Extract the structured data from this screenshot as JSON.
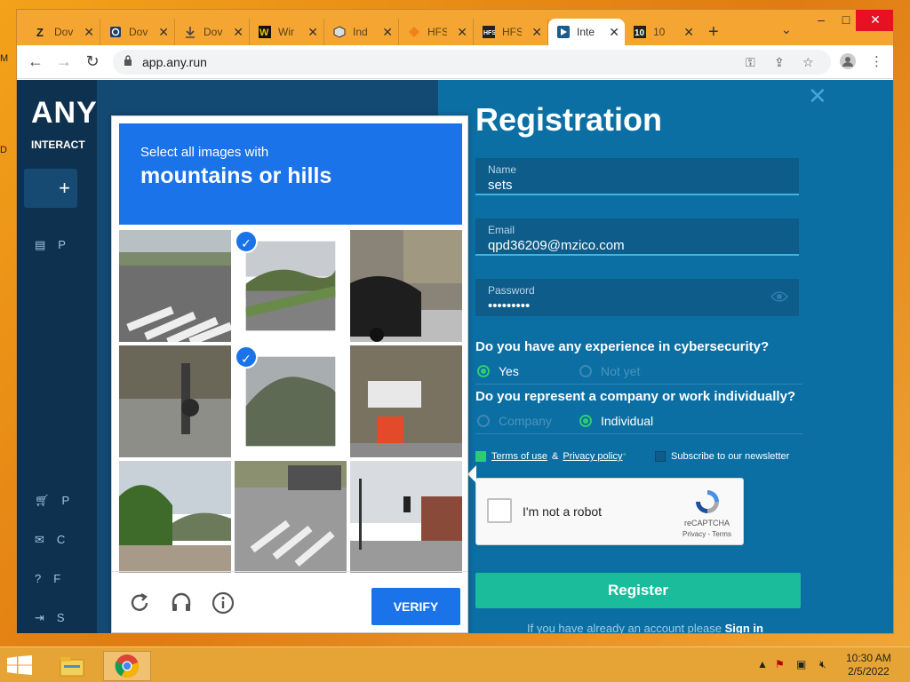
{
  "browser": {
    "tabs": [
      {
        "favicon": "zippyshare-icon",
        "label": "Dov"
      },
      {
        "favicon": "download-q-icon",
        "label": "Dov"
      },
      {
        "favicon": "download-arrow-icon",
        "label": "Dov"
      },
      {
        "favicon": "w-icon",
        "label": "Wir"
      },
      {
        "favicon": "index-icon",
        "label": "Ind"
      },
      {
        "favicon": "hfs-diamond-icon",
        "label": "HFS"
      },
      {
        "favicon": "hfs-icon",
        "label": "HFS"
      },
      {
        "favicon": "anyrun-icon",
        "label": "Inte"
      },
      {
        "favicon": "ten-icon",
        "label": "10"
      }
    ],
    "url": "app.any.run"
  },
  "sidebar": {
    "brand": "ANY",
    "subtitle": "INTERACT",
    "items": [
      {
        "icon": "document-icon",
        "label": "P"
      },
      {
        "icon": "cart-icon",
        "label": "P"
      },
      {
        "icon": "mail-icon",
        "label": "C"
      },
      {
        "icon": "help-icon",
        "label": "F"
      },
      {
        "icon": "signin-icon",
        "label": "S"
      }
    ]
  },
  "registration": {
    "title": "Registration",
    "name_label": "Name",
    "name_value": "sets",
    "email_label": "Email",
    "email_value": "qpd36209@mzico.com",
    "password_label": "Password",
    "password_value": "•••••••••",
    "q1": "Do you have any experience in cybersecurity?",
    "q1_yes": "Yes",
    "q1_no": "Not yet",
    "q2": "Do you represent a company or work individually?",
    "q2_company": "Company",
    "q2_individual": "Individual",
    "terms": "Terms of use",
    "amp": "&",
    "privacy": "Privacy policy",
    "asterisk": "*",
    "newsletter": "Subscribe to our newsletter",
    "register": "Register",
    "signin_prompt": "If you have already an account please",
    "signin_link": "Sign in"
  },
  "recaptcha": {
    "label": "I'm not a robot",
    "brand": "reCAPTCHA",
    "links": "Privacy - Terms"
  },
  "challenge": {
    "line1": "Select all images with",
    "line2": "mountains or hills",
    "verify": "VERIFY",
    "tiles": [
      {
        "scene": "crosswalk-street",
        "selected": false
      },
      {
        "scene": "mountain-road",
        "selected": true
      },
      {
        "scene": "parked-car",
        "selected": false
      },
      {
        "scene": "street-people",
        "selected": false
      },
      {
        "scene": "hill-trees",
        "selected": true
      },
      {
        "scene": "car-street-corner",
        "selected": false
      },
      {
        "scene": "river-hills",
        "selected": false
      },
      {
        "scene": "truck-crosswalk",
        "selected": false
      },
      {
        "scene": "traffic-light-street",
        "selected": false
      }
    ]
  },
  "taskbar": {
    "time": "10:30 AM",
    "date": "2/5/2022"
  },
  "colors": {
    "accent": "#1a73e8",
    "register": "#1abc9c",
    "panel": "#0b6fa3",
    "radio_on": "#2ecc71"
  }
}
